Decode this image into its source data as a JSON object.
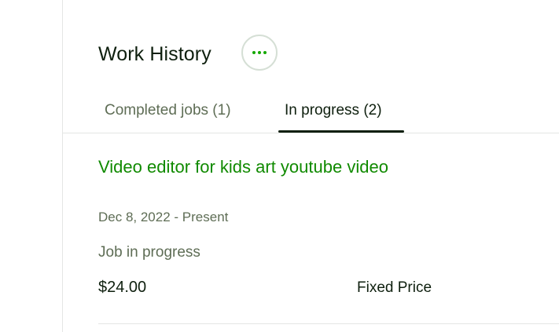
{
  "section": {
    "title": "Work History",
    "more_icon": "more-horizontal-icon"
  },
  "tabs": [
    {
      "label": "Completed jobs (1)",
      "active": false
    },
    {
      "label": "In progress (2)",
      "active": true
    }
  ],
  "jobs": [
    {
      "title": "Video editor for kids art youtube video",
      "date_range": "Dec 8, 2022 - Present",
      "status": "Job in progress",
      "price": "$24.00",
      "price_type": "Fixed Price"
    }
  ],
  "colors": {
    "accent": "#14a800",
    "link": "#108a00",
    "text": "#0e1f0e",
    "muted": "#5e6d55"
  }
}
